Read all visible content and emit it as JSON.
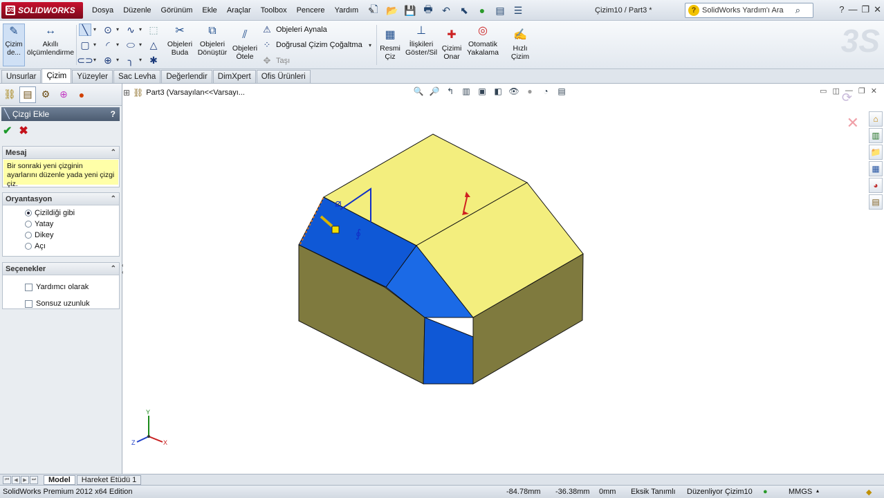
{
  "app": {
    "logo_text": "SOLIDWORKS",
    "document_title": "Çizim10 / Part3 *",
    "edition": "SolidWorks Premium 2012 x64 Edition"
  },
  "menu": [
    "Dosya",
    "Düzenle",
    "Görünüm",
    "Ekle",
    "Araçlar",
    "Toolbox",
    "Pencere",
    "Yardım"
  ],
  "search": {
    "placeholder": "SolidWorks Yardım'ı Ara"
  },
  "commands": {
    "sketch": "Çizim de...",
    "smart_dimension": "Akıllı ölçümlendirme",
    "trim": "Objeleri Buda",
    "convert": "Objeleri Dönüştür",
    "offset": "Objeleri Ötele",
    "mirror": "Objeleri Aynala",
    "linear_pattern": "Doğrusal Çizim Çoğaltma",
    "move": "Taşı",
    "display_grid": "Resmi Çiz",
    "relations": "İlişkileri Göster/Sil",
    "repair": "Çizimi Onar",
    "quick_snaps": "Otomatik Yakalama",
    "rapid_sketch": "Hızlı Çizim"
  },
  "tabs": [
    {
      "label": "Unsurlar",
      "active": false
    },
    {
      "label": "Çizim",
      "active": true
    },
    {
      "label": "Yüzeyler",
      "active": false
    },
    {
      "label": "Sac Levha",
      "active": false
    },
    {
      "label": "Değerlendir",
      "active": false
    },
    {
      "label": "DimXpert",
      "active": false
    },
    {
      "label": "Ofis Ürünleri",
      "active": false
    }
  ],
  "property_manager": {
    "title": "Çizgi Ekle",
    "help": "?",
    "message_title": "Mesaj",
    "message": "Bir sonraki yeni çizginin ayarlarını düzenle yada yeni çizgi çiz.",
    "orientation_title": "Oryantasyon",
    "orientation_options": [
      {
        "label": "Çizildiği gibi",
        "selected": true
      },
      {
        "label": "Yatay",
        "selected": false
      },
      {
        "label": "Dikey",
        "selected": false
      },
      {
        "label": "Açı",
        "selected": false
      }
    ],
    "options_title": "Seçenekler",
    "options": [
      {
        "label": "Yardımcı olarak",
        "checked": false
      },
      {
        "label": "Sonsuz uzunluk",
        "checked": false
      }
    ]
  },
  "tree_flyout": "Part3  (Varsayılan<<Varsayı...",
  "bottom_tabs": [
    {
      "label": "Model",
      "active": true
    },
    {
      "label": "Hareket Etüdü 1",
      "active": false
    }
  ],
  "status": {
    "x": "-84.78mm",
    "y": "-36.38mm",
    "z": "0mm",
    "definition": "Eksik Tanımlı",
    "editing": "Düzenliyor Çizim10",
    "units": "MMGS"
  },
  "colors": {
    "top_face": "#f3ee7e",
    "side_face": "#7f7a3e",
    "selected_face": "#0f58d6",
    "accent": "#1b4a8a"
  },
  "triad": {
    "x": "X",
    "y": "Y",
    "z": "Z"
  }
}
